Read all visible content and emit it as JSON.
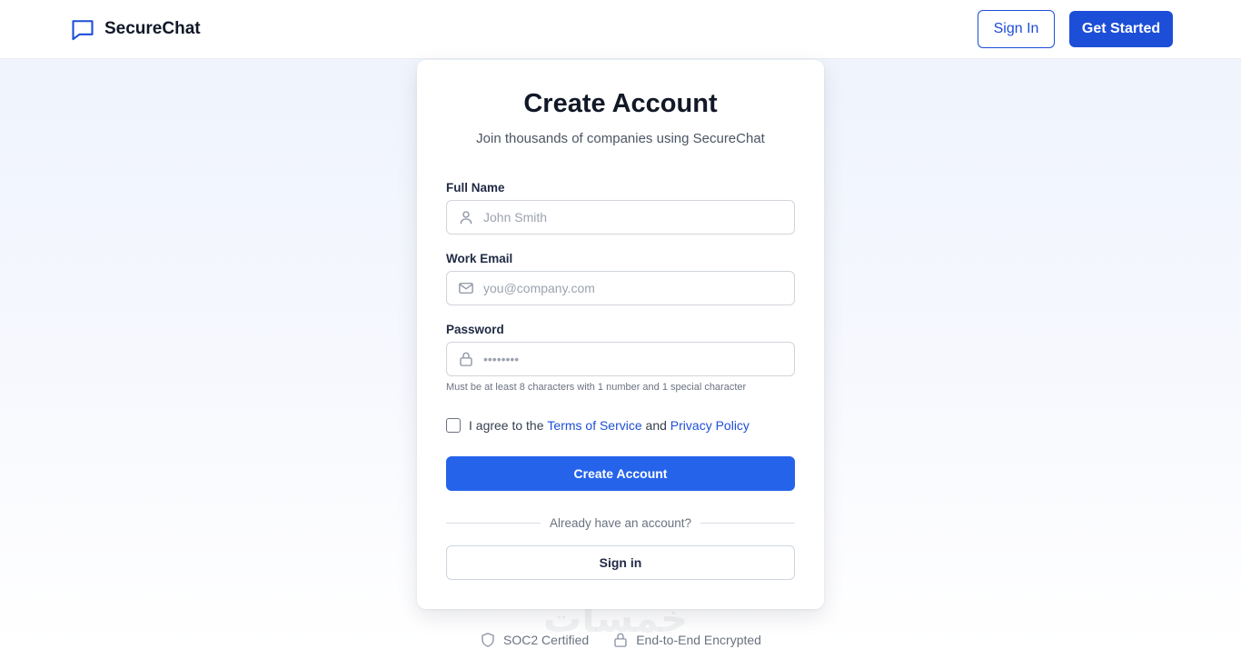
{
  "header": {
    "brand_name": "SecureChat",
    "brand_icon": "chat-bubble-icon",
    "sign_in_label": "Sign In",
    "get_started_label": "Get Started"
  },
  "card": {
    "title": "Create Account",
    "subtitle": "Join thousands of companies using SecureChat",
    "fields": {
      "full_name": {
        "label": "Full Name",
        "placeholder": "John Smith",
        "value": "",
        "icon": "user-icon"
      },
      "work_email": {
        "label": "Work Email",
        "placeholder": "you@company.com",
        "value": "",
        "icon": "mail-icon"
      },
      "password": {
        "label": "Password",
        "placeholder": "••••••••",
        "value": "",
        "icon": "lock-icon",
        "helper": "Must be at least 8 characters with 1 number and 1 special character"
      }
    },
    "agree": {
      "prefix": "I agree to the ",
      "terms_link": "Terms of Service",
      "middle": " and ",
      "privacy_link": "Privacy Policy",
      "checked": false
    },
    "create_button": "Create Account",
    "divider_text": "Already have an account?",
    "sign_in_button": "Sign in"
  },
  "footer": {
    "badges": [
      {
        "label": "SOC2 Certified",
        "icon": "shield-icon"
      },
      {
        "label": "End-to-End Encrypted",
        "icon": "lock-icon"
      }
    ]
  },
  "watermark": "خمسات",
  "colors": {
    "primary": "#2563eb",
    "primary_dark": "#1d4ed8",
    "text": "#111827",
    "muted": "#6b7280"
  }
}
